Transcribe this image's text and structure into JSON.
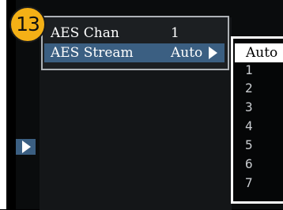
{
  "callout": {
    "number": "13"
  },
  "menu": {
    "rows": [
      {
        "label": "AES Chan",
        "value": "1"
      },
      {
        "label": "AES Stream",
        "value": "Auto"
      }
    ]
  },
  "dropdown": {
    "selected": "Auto",
    "options": [
      "1",
      "2",
      "3",
      "4",
      "5",
      "6",
      "7"
    ]
  },
  "colors": {
    "selection": "#3b5f82",
    "callout": "#f4b016",
    "dropdown_border": "#ffffff"
  }
}
